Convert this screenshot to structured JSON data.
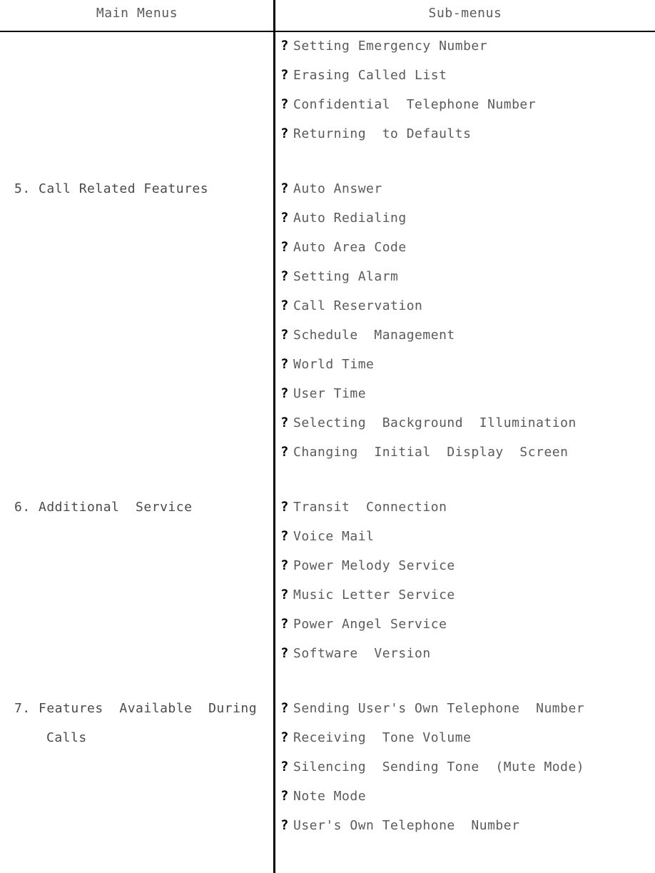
{
  "table": {
    "headers": {
      "main": "Main Menus",
      "sub": "Sub-menus"
    },
    "bullet_glyph": "?",
    "colors": {
      "rule": "#000000",
      "text": "#5a5a5a",
      "bullet": "#000000",
      "background": "#ffffff"
    },
    "groups": [
      {
        "main": "",
        "main_continuation": "",
        "submenus": [
          "Setting Emergency Number",
          "Erasing Called List",
          "Confidential  Telephone Number",
          "Returning  to Defaults"
        ]
      },
      {
        "main": "5. Call Related Features",
        "main_continuation": "",
        "submenus": [
          "Auto Answer",
          "Auto Redialing",
          "Auto Area Code",
          "Setting Alarm",
          "Call Reservation",
          "Schedule  Management",
          "World Time",
          "User Time",
          "Selecting  Background  Illumination",
          "Changing  Initial  Display  Screen"
        ]
      },
      {
        "main": "6. Additional  Service",
        "main_continuation": "",
        "submenus": [
          "Transit  Connection",
          "Voice Mail",
          "Power Melody Service",
          "Music Letter Service",
          "Power Angel Service",
          "Software  Version"
        ]
      },
      {
        "main": "7. Features  Available  During",
        "main_continuation": "Calls",
        "submenus": [
          "Sending User's Own Telephone  Number",
          "Receiving  Tone Volume",
          "Silencing  Sending Tone  (Mute Mode)",
          "Note Mode",
          "User's Own Telephone  Number"
        ]
      }
    ]
  }
}
